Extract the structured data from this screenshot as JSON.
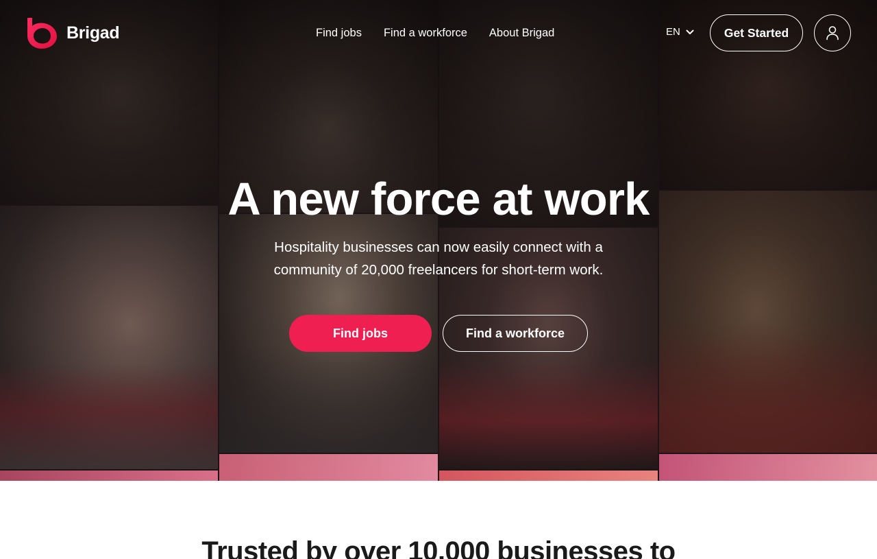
{
  "brand": {
    "name": "Brigad",
    "accent_color": "#ef1f52"
  },
  "nav": {
    "links": [
      {
        "label": "Find jobs"
      },
      {
        "label": "Find a workforce"
      },
      {
        "label": "About Brigad"
      }
    ],
    "language": "EN",
    "get_started_label": "Get Started",
    "user_icon": "user-icon"
  },
  "hero": {
    "title": "A new force at work",
    "subtitle_line1": "Hospitality businesses can now easily connect with a",
    "subtitle_line2": "community of 20,000 freelancers for short-term work.",
    "primary_cta": "Find jobs",
    "secondary_cta": "Find a workforce"
  },
  "section": {
    "heading": "Trusted by over 10,000 businesses to"
  }
}
